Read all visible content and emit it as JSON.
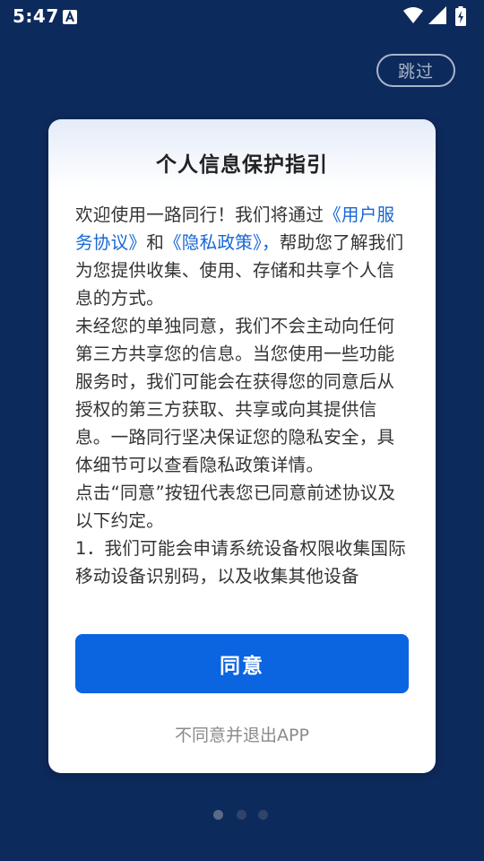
{
  "status_bar": {
    "time": "5:47",
    "icons": [
      "text-a-icon",
      "wifi-icon",
      "signal-icon",
      "battery-charging-icon"
    ]
  },
  "skip_label": "跳过",
  "dialog": {
    "title": "个人信息保护指引",
    "paragraph1": {
      "text_before": "欢迎使用一路同行！我们将通过",
      "user_agreement_link": "《用户服务协议》",
      "and_text": "和",
      "privacy_policy_link": "《隐私政策》，",
      "text_after": "帮助您了解我们为您提供收集、使用、存储和共享个人信息的方式。"
    },
    "paragraph2": "未经您的单独同意，我们不会主动向任何第三方共享您的信息。当您使用一些功能服务时，我们可能会在获得您的同意后从授权的第三方获取、共享或向其提供信息。一路同行坚决保证您的隐私安全，具体细节可以查看隐私政策详情。",
    "paragraph3": "点击“同意”按钮代表您已同意前述协议及以下约定。",
    "paragraph4": "1．我们可能会申请系统设备权限收集国际移动设备识别码，以及收集其他设备",
    "agree_label": "同意",
    "disagree_label": "不同意并退出APP"
  },
  "pagination": {
    "total": 3,
    "current": 1
  },
  "colors": {
    "background": "#0d2a5c",
    "accent": "#0b64e0",
    "link": "#1766d6"
  }
}
